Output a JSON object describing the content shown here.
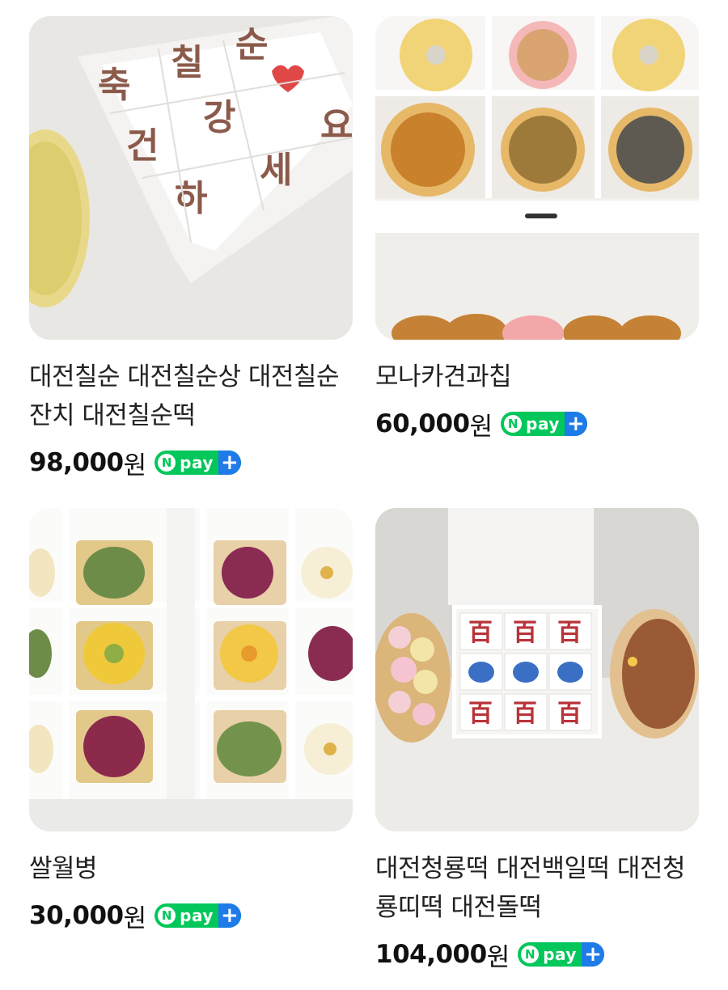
{
  "products": [
    {
      "title": "대전칠순 대전칠순상 대전칠순잔치 대전칠순떡",
      "price": "98,000",
      "currency": "원",
      "badge": {
        "n": "N",
        "pay": "pay",
        "plus": "+"
      },
      "image_alt_chars": [
        "축",
        "칠",
        "순",
        "건",
        "강",
        "하",
        "세",
        "요"
      ]
    },
    {
      "title": "모나카견과칩",
      "price": "60,000",
      "currency": "원",
      "badge": {
        "n": "N",
        "pay": "pay",
        "plus": "+"
      }
    },
    {
      "title": "쌀월병",
      "price": "30,000",
      "currency": "원",
      "badge": {
        "n": "N",
        "pay": "pay",
        "plus": "+"
      }
    },
    {
      "title": "대전청룡떡 대전백일떡 대전청룡띠떡 대전돌떡",
      "price": "104,000",
      "currency": "원",
      "badge": {
        "n": "N",
        "pay": "pay",
        "plus": "+"
      },
      "image_chars": [
        "百",
        "百",
        "百",
        "百",
        "百",
        "百"
      ]
    }
  ],
  "colors": {
    "npay_green": "#03c75a",
    "npay_blue": "#1e7be8"
  }
}
